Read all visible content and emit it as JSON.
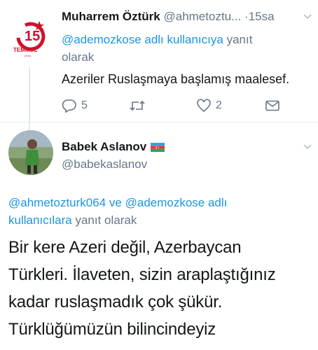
{
  "tweet1": {
    "avatar_badge": "15 TEMMUZ 2016",
    "name": "Muharrem Öztürk",
    "handle": "@ahmetoztu...",
    "dot": "·",
    "time": "15sa",
    "reply_mention": "@ademozkose adlı kullanıcıya",
    "reply_suffix": "yanıt",
    "reply_line2": "olarak",
    "text": "Azeriler Ruslaşmaya başlamış maalesef.",
    "actions": {
      "reply_icon": "reply-icon",
      "reply_count": "5",
      "retweet_icon": "retweet-icon",
      "like_icon": "heart-icon",
      "like_count": "2",
      "dm_icon": "envelope-icon"
    }
  },
  "tweet2": {
    "name": "Babek Aslanov",
    "flag": "azerbaijan-flag-icon",
    "handle": "@babekaslanov",
    "reply_line1_mention1": "@ahmetozturk064",
    "reply_line1_and": "ve",
    "reply_line1_mention2": "@ademozkose adlı",
    "reply_line2_mention": "kullanıcılara",
    "reply_line2_suffix": "yanıt olarak",
    "lines": [
      "Bir kere Azeri değil, Azerbaycan",
      "Türkleri. İlaveten, sizin araplaştığınız",
      "kadar ruslaşmadık çok şükür.",
      "Türklüğümüzün bilincindeyiz"
    ]
  },
  "colors": {
    "link": "#1b95e0",
    "secondary_text": "#657786",
    "primary_text": "#14171a",
    "badge_red": "#d0112b"
  }
}
